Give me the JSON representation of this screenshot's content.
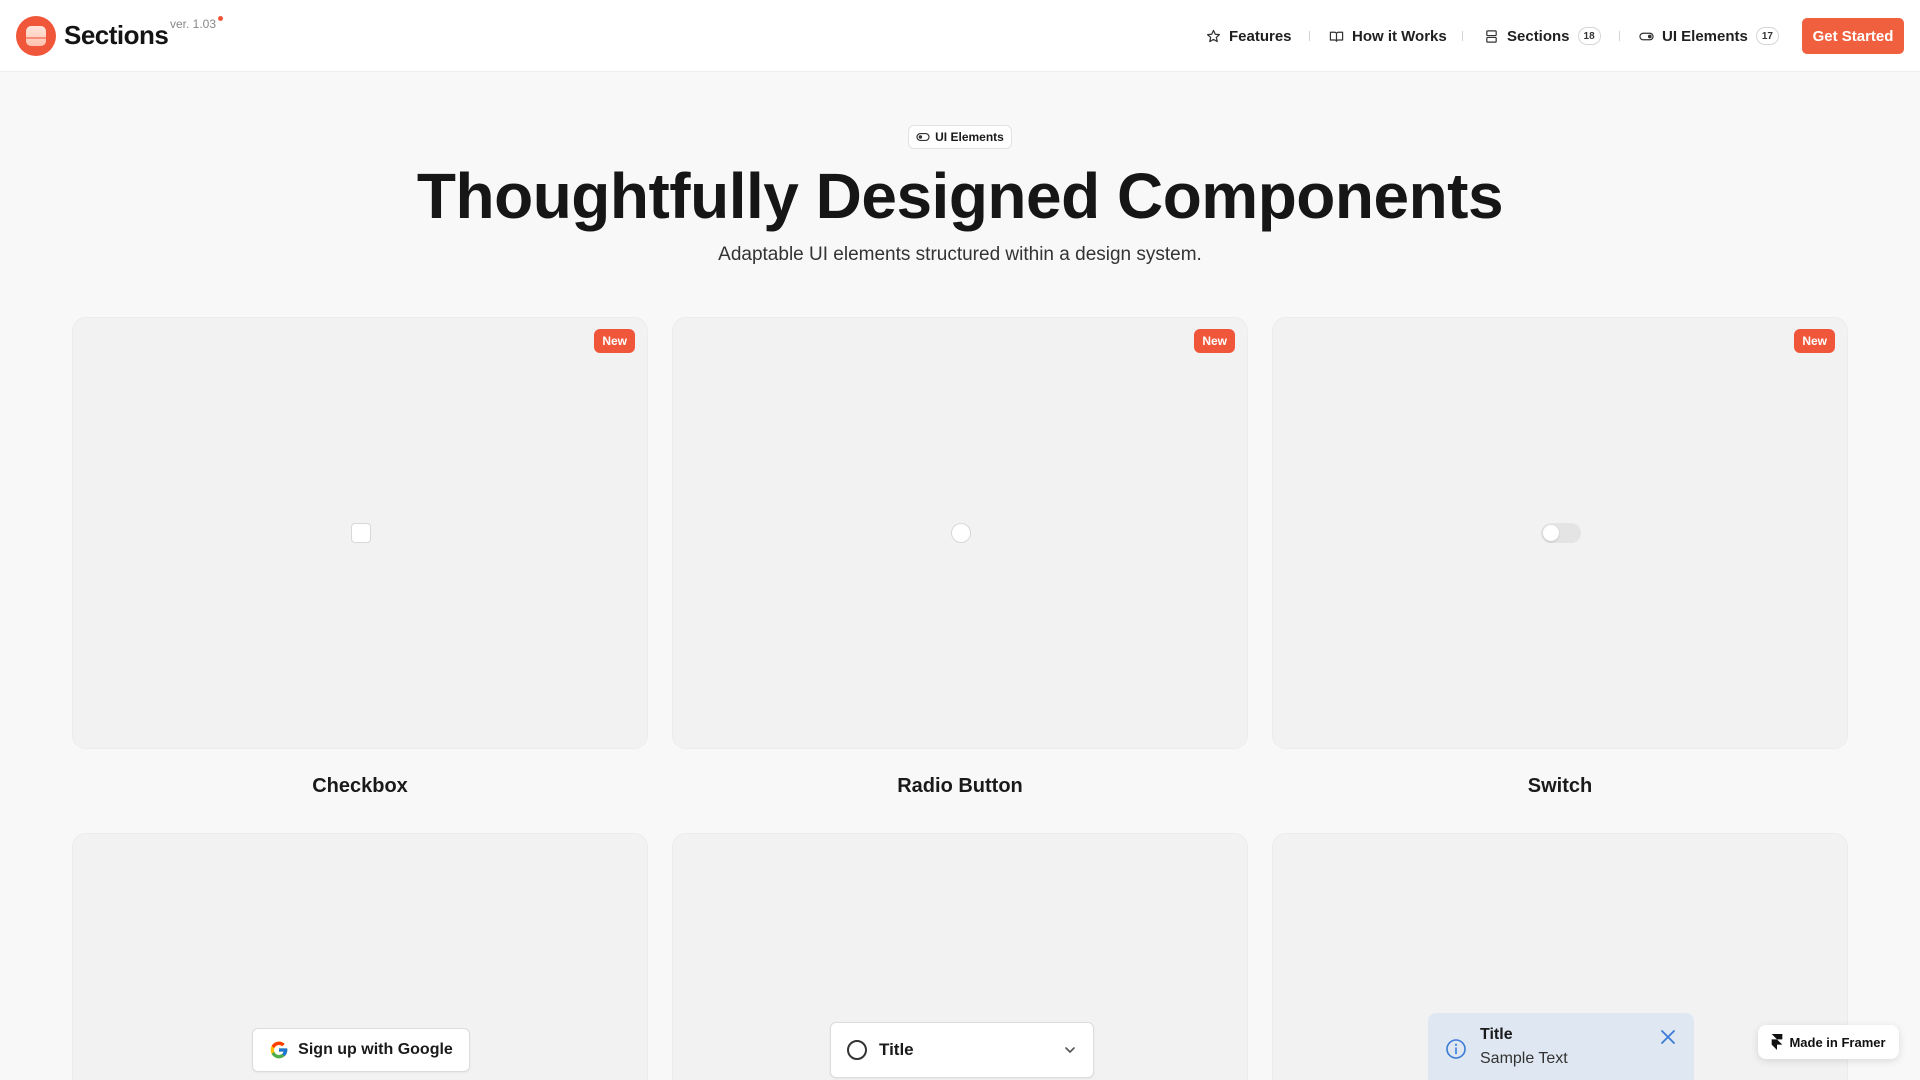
{
  "header": {
    "brand": "Sections",
    "version": "ver. 1.03",
    "nav": [
      {
        "label": "Features",
        "icon": "star-icon"
      },
      {
        "label": "How it Works",
        "icon": "book-icon"
      },
      {
        "label": "Sections",
        "icon": "sections-icon",
        "count": "18"
      },
      {
        "label": "UI Elements",
        "icon": "toggle-icon",
        "count": "17"
      }
    ],
    "cta": "Get Started"
  },
  "hero": {
    "pill": "UI Elements",
    "title": "Thoughtfully Designed Components",
    "subtitle": "Adaptable UI elements structured within a design system."
  },
  "cards": [
    {
      "badge": "New",
      "label": "Checkbox"
    },
    {
      "badge": "New",
      "label": "Radio Button"
    },
    {
      "badge": "New",
      "label": "Switch"
    }
  ],
  "google_button": "Sign up with Google",
  "select": {
    "title": "Title"
  },
  "toast": {
    "title": "Title",
    "text": "Sample Text"
  },
  "framer_badge": "Made in Framer",
  "colors": {
    "accent": "#f0573a",
    "card_bg": "#f2f2f2",
    "page_bg": "#f8f8f8",
    "toast_bg": "#dfe8f2",
    "info_blue": "#3b7bd6"
  }
}
